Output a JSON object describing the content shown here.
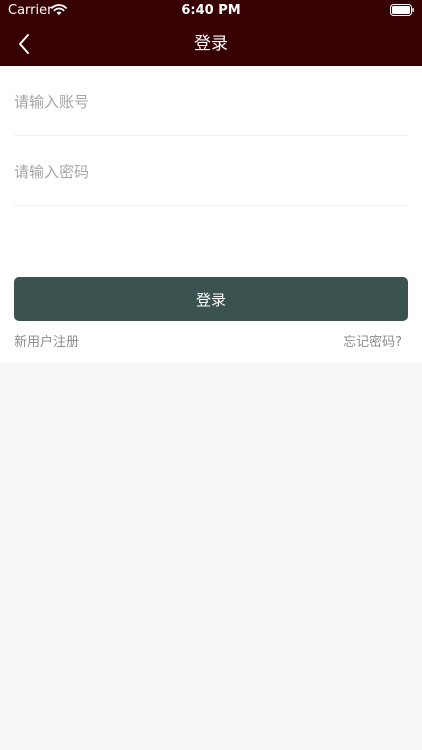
{
  "status_bar": {
    "carrier": "Carrier",
    "time": "6:40 PM"
  },
  "nav": {
    "title": "登录",
    "back_icon": "chevron-left-icon"
  },
  "form": {
    "account_placeholder": "请输入账号",
    "account_value": "",
    "password_placeholder": "请输入密码",
    "password_value": "",
    "login_label": "登录",
    "register_label": "新用户注册",
    "forgot_label": "忘记密码?"
  },
  "colors": {
    "header_bg": "#370103",
    "button_bg": "#3a5350",
    "page_bg": "#f7f7f7",
    "link_text": "#8c8c8c"
  }
}
